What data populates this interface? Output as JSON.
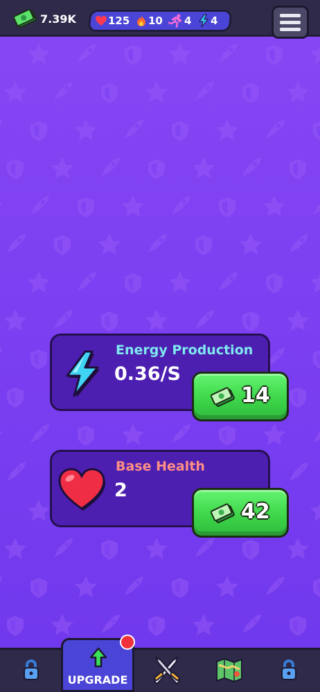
{
  "header": {
    "cash": "7.39K",
    "stats": [
      {
        "icon": "heart-icon",
        "value": "125"
      },
      {
        "icon": "fire-icon",
        "value": "10"
      },
      {
        "icon": "runner-icon",
        "value": "4"
      },
      {
        "icon": "lightning-icon",
        "value": "4"
      }
    ],
    "menu_icon": "hamburger-menu-icon"
  },
  "upgrades": [
    {
      "title": "Energy Production",
      "value": "0.36/S",
      "price": "14",
      "icon": "lightning-icon",
      "title_color": "#7fe9f0"
    },
    {
      "title": "Base Health",
      "value": "2",
      "price": "42",
      "icon": "heart-icon",
      "title_color": "#ff8f86"
    }
  ],
  "nav": {
    "items": [
      {
        "icon": "lock-icon"
      },
      {
        "label": "UPGRADE",
        "icon": "arrow-up-icon",
        "active": true
      },
      {
        "icon": "crossed-swords-icon"
      },
      {
        "icon": "map-icon"
      },
      {
        "icon": "lock-icon"
      }
    ]
  },
  "colors": {
    "background": "#7a3ff0",
    "topbar": "#2f2a4a",
    "stats_pill": "#4a45d6",
    "card": "#4d1fb0",
    "buy_button": "#3ed64a"
  }
}
